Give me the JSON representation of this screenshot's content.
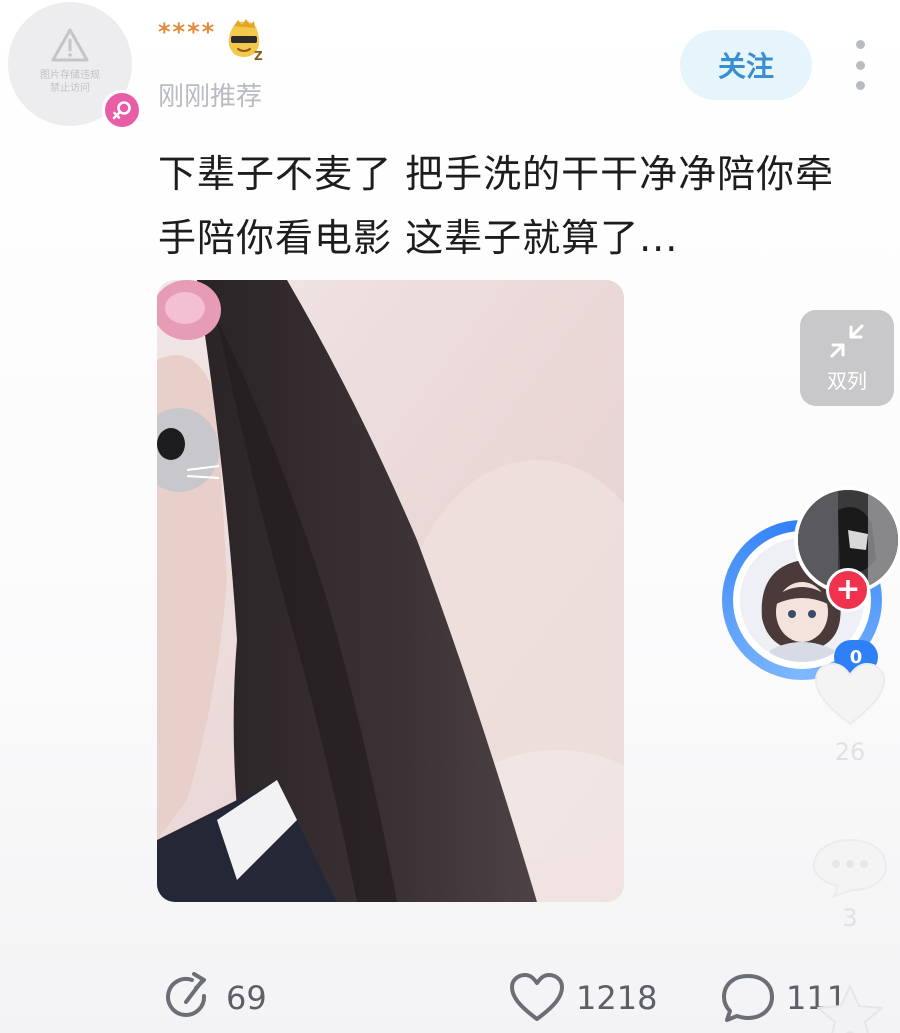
{
  "author": {
    "name": "****",
    "post_time": "刚刚推荐",
    "avatar_notice": "图片存储违规\n禁止访问",
    "gender_icon": "female-icon",
    "vip_icon": "vip-sunglasses-badge-icon"
  },
  "header": {
    "follow_label": "关注",
    "more_icon": "more-vertical-icon"
  },
  "post": {
    "text": "下辈子不麦了 把手洗的干干净净陪你牵手陪你看电影 这辈子就算了..."
  },
  "side_rail": {
    "dual_column_label": "双列",
    "creator_badge": "0",
    "like_count": "26",
    "comment_count": "3"
  },
  "actions": {
    "share_count": "69",
    "like_count": "1218",
    "comment_count": "111"
  },
  "colors": {
    "accent_blue": "#3a8fd0",
    "follow_bg": "#e6f4fc",
    "gender_pink": "#e85ea6",
    "add_red": "#f0324f",
    "ring_blue": "#2f7ff7"
  }
}
